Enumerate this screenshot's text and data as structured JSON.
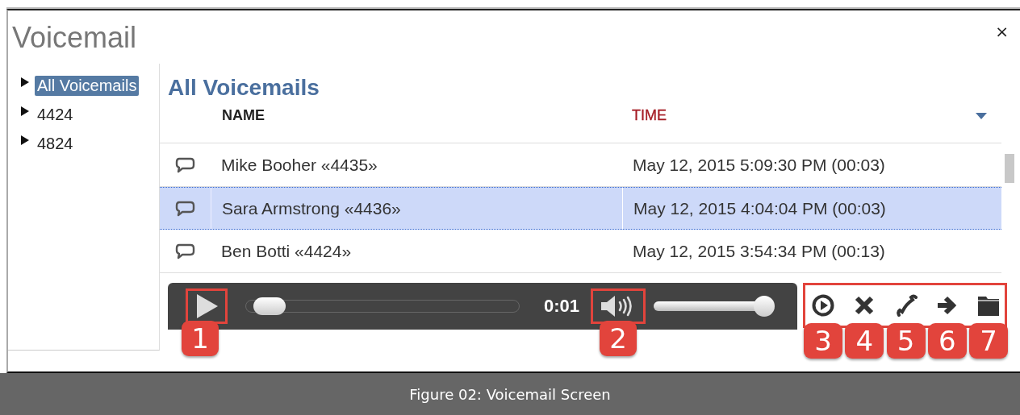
{
  "window": {
    "title": "Voicemail",
    "close": "×"
  },
  "sidebar": {
    "items": [
      {
        "label": "All Voicemails",
        "selected": true
      },
      {
        "label": "4424",
        "selected": false
      },
      {
        "label": "4824",
        "selected": false
      }
    ]
  },
  "list": {
    "heading": "All Voicemails",
    "columns": [
      {
        "label": "NAME",
        "sorted": false
      },
      {
        "label": "TIME",
        "sorted": true
      }
    ],
    "rows": [
      {
        "name": "Mike Booher «4435»",
        "time": "May 12, 2015 5:09:30 PM (00:03)",
        "selected": false
      },
      {
        "name": "Sara Armstrong «4436»",
        "time": "May 12, 2015 4:04:04 PM (00:03)",
        "selected": true
      },
      {
        "name": "Ben Botti «4424»",
        "time": "May 12, 2015 3:54:34 PM (00:13)",
        "selected": false
      }
    ]
  },
  "player": {
    "play_callout": "1",
    "seek": {
      "level": 0.03
    },
    "elapsed": "0:01",
    "volume_callout": "2",
    "volume": {
      "level": 1
    }
  },
  "actions": {
    "highlighted": true,
    "items": [
      {
        "kind": "play",
        "callout": "3"
      },
      {
        "kind": "delete",
        "callout": "4"
      },
      {
        "kind": "call",
        "callout": "5"
      },
      {
        "kind": "forward",
        "callout": "6"
      },
      {
        "kind": "folder",
        "callout": "7"
      }
    ]
  },
  "caption": "Figure 02: Voicemail Screen"
}
